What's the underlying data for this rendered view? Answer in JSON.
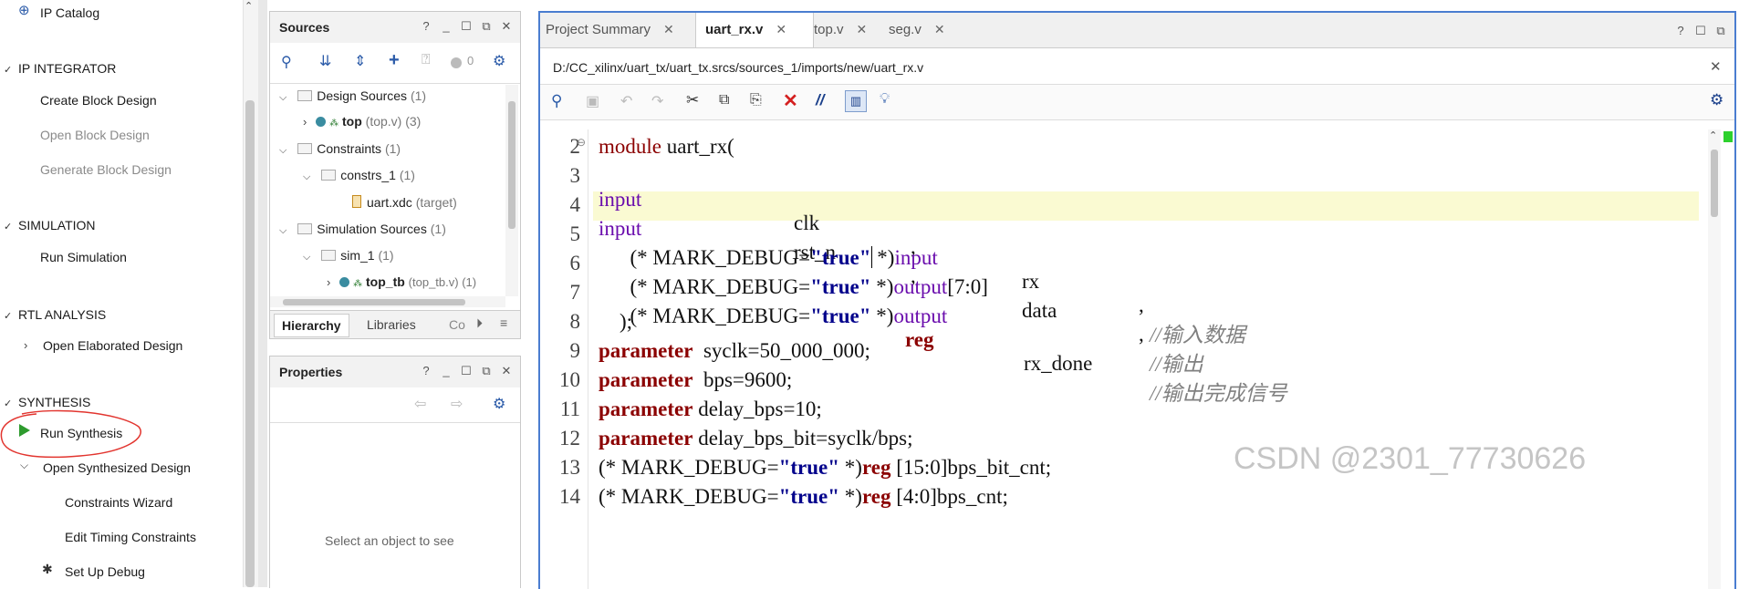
{
  "flow": {
    "ip_catalog": "IP Catalog",
    "ip_integrator": "IP INTEGRATOR",
    "create_block_design": "Create Block Design",
    "open_block_design": "Open Block Design",
    "generate_block_design": "Generate Block Design",
    "simulation": "SIMULATION",
    "run_simulation": "Run Simulation",
    "rtl_analysis": "RTL ANALYSIS",
    "open_elaborated_design": "Open Elaborated Design",
    "synthesis": "SYNTHESIS",
    "run_synthesis": "Run Synthesis",
    "open_synthesized_design": "Open Synthesized Design",
    "constraints_wizard": "Constraints Wizard",
    "edit_timing_constraints": "Edit Timing Constraints",
    "set_up_debug": "Set Up Debug"
  },
  "sources": {
    "title": "Sources",
    "badge_count": "0",
    "design_sources": "Design Sources",
    "design_sources_count": "(1)",
    "top_name": "top",
    "top_file": "(top.v) (3)",
    "constraints": "Constraints",
    "constraints_count": "(1)",
    "constrs_1": "constrs_1",
    "constrs_1_count": "(1)",
    "uart_xdc": "uart.xdc",
    "uart_xdc_tag": "(target)",
    "simulation_sources": "Simulation Sources",
    "simulation_sources_count": "(1)",
    "sim_1": "sim_1",
    "sim_1_count": "(1)",
    "top_tb_name": "top_tb",
    "top_tb_file": "(top_tb.v) (1)",
    "tabs": [
      "Hierarchy",
      "Libraries",
      "Co"
    ]
  },
  "properties": {
    "title": "Properties",
    "empty_text": "Select an object to see"
  },
  "editor": {
    "tabs": [
      "Project Summary",
      "uart_rx.v",
      "top.v",
      "seg.v"
    ],
    "path": "D:/CC_xilinx/uart_tx/uart_tx.srcs/sources_1/imports/new/uart_rx.v",
    "line_numbers": [
      "2",
      "3",
      "4",
      "5",
      "6",
      "7",
      "8",
      "9",
      "10",
      "11",
      "12",
      "13",
      "14"
    ],
    "tokens": {
      "module": "module",
      "module_name": " uart_rx(",
      "input": "input",
      "output": "output",
      "reg": "reg",
      "parameter": "parameter",
      "mark_open": "(* MARK_DEBUG=",
      "true_str": "\"true\"",
      "mark_close": " *)",
      "clk": "clk",
      "rst_n": "rst_n",
      "rx": "rx",
      "data_range": "[7:0]",
      "data": "data",
      "rx_done": "rx_done",
      "comma": ",",
      "cm_rx": "//输入数据",
      "cm_data": "//输出",
      "cm_done": "//输出完成信号",
      "close_paren": "    );",
      "p_syclk": "  syclk=50_000_000;",
      "p_bps": "  bps=9600;",
      "p_delay": " delay_bps=10;",
      "p_delay_bit": " delay_bps_bit=syclk/bps;",
      "bps_bit_cnt": " [15:0]bps_bit_cnt;",
      "bps_cnt": " [4:0]bps_cnt;"
    }
  },
  "watermark": "CSDN @2301_77730626",
  "colors": {
    "editor_border": "#4a7dd0",
    "current_line": "#fafad2",
    "keyword": "#8b0000",
    "port": "#6a0dad",
    "string": "#00008b",
    "comment": "#808080"
  }
}
